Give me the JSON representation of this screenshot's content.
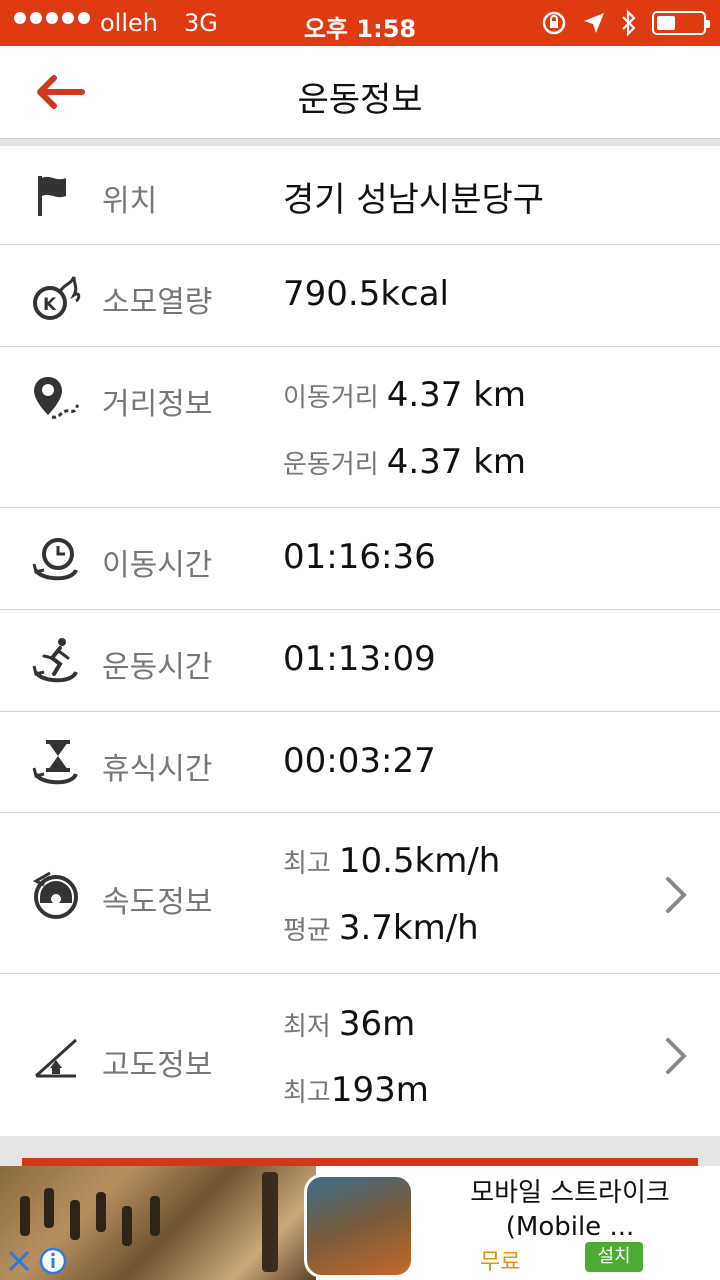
{
  "status_bar": {
    "carrier": "olleh",
    "network": "3G",
    "time": "오후 1:58"
  },
  "nav": {
    "title": "운동정보"
  },
  "rows": {
    "location": {
      "icon": "flag-icon",
      "label": "위치",
      "value": "경기 성남시분당구"
    },
    "calories": {
      "icon": "kcal-fire-icon",
      "label": "소모열량",
      "value": "790.5kcal"
    },
    "distance": {
      "icon": "map-pin-route-icon",
      "label": "거리정보",
      "move_label": "이동거리",
      "move_value": "4.37 km",
      "exercise_label": "운동거리",
      "exercise_value": "4.37 km"
    },
    "move_time": {
      "icon": "clock-cycle-icon",
      "label": "이동시간",
      "value": "01:16:36"
    },
    "exercise_time": {
      "icon": "runner-cycle-icon",
      "label": "운동시간",
      "value": "01:13:09"
    },
    "rest_time": {
      "icon": "hourglass-cycle-icon",
      "label": "휴식시간",
      "value": "00:03:27"
    },
    "speed": {
      "icon": "speedometer-icon",
      "label": "속도정보",
      "max_label": "최고",
      "max_value": "10.5km/h",
      "avg_label": "평균",
      "avg_value": "3.7km/h"
    },
    "altitude": {
      "icon": "altitude-icon",
      "label": "고도정보",
      "min_label": "최저",
      "min_value": "36m",
      "max_label": "최고",
      "max_value": "193m"
    }
  },
  "ad": {
    "app_name": "모바일 스트라이크 (Mobile ...",
    "price": "무료",
    "install": "설치"
  },
  "colors": {
    "accent": "#e03a12",
    "label": "#777777",
    "divider": "#d3d3d3",
    "icon": "#333333",
    "install_green": "#4caa35",
    "price_orange": "#e8900e"
  }
}
